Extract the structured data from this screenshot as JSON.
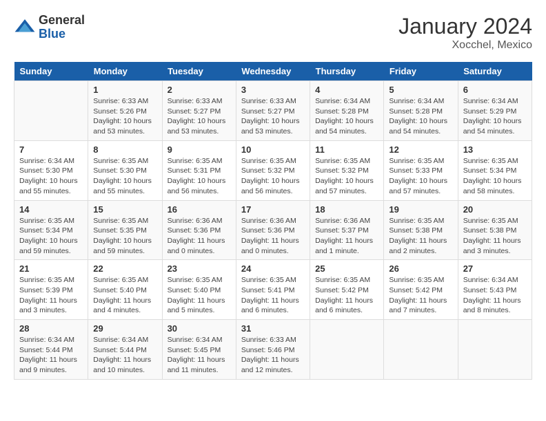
{
  "header": {
    "logo_general": "General",
    "logo_blue": "Blue",
    "month_year": "January 2024",
    "location": "Xocchel, Mexico"
  },
  "days_of_week": [
    "Sunday",
    "Monday",
    "Tuesday",
    "Wednesday",
    "Thursday",
    "Friday",
    "Saturday"
  ],
  "weeks": [
    [
      {
        "day": "",
        "info": ""
      },
      {
        "day": "1",
        "info": "Sunrise: 6:33 AM\nSunset: 5:26 PM\nDaylight: 10 hours\nand 53 minutes."
      },
      {
        "day": "2",
        "info": "Sunrise: 6:33 AM\nSunset: 5:27 PM\nDaylight: 10 hours\nand 53 minutes."
      },
      {
        "day": "3",
        "info": "Sunrise: 6:33 AM\nSunset: 5:27 PM\nDaylight: 10 hours\nand 53 minutes."
      },
      {
        "day": "4",
        "info": "Sunrise: 6:34 AM\nSunset: 5:28 PM\nDaylight: 10 hours\nand 54 minutes."
      },
      {
        "day": "5",
        "info": "Sunrise: 6:34 AM\nSunset: 5:28 PM\nDaylight: 10 hours\nand 54 minutes."
      },
      {
        "day": "6",
        "info": "Sunrise: 6:34 AM\nSunset: 5:29 PM\nDaylight: 10 hours\nand 54 minutes."
      }
    ],
    [
      {
        "day": "7",
        "info": "Sunrise: 6:34 AM\nSunset: 5:30 PM\nDaylight: 10 hours\nand 55 minutes."
      },
      {
        "day": "8",
        "info": "Sunrise: 6:35 AM\nSunset: 5:30 PM\nDaylight: 10 hours\nand 55 minutes."
      },
      {
        "day": "9",
        "info": "Sunrise: 6:35 AM\nSunset: 5:31 PM\nDaylight: 10 hours\nand 56 minutes."
      },
      {
        "day": "10",
        "info": "Sunrise: 6:35 AM\nSunset: 5:32 PM\nDaylight: 10 hours\nand 56 minutes."
      },
      {
        "day": "11",
        "info": "Sunrise: 6:35 AM\nSunset: 5:32 PM\nDaylight: 10 hours\nand 57 minutes."
      },
      {
        "day": "12",
        "info": "Sunrise: 6:35 AM\nSunset: 5:33 PM\nDaylight: 10 hours\nand 57 minutes."
      },
      {
        "day": "13",
        "info": "Sunrise: 6:35 AM\nSunset: 5:34 PM\nDaylight: 10 hours\nand 58 minutes."
      }
    ],
    [
      {
        "day": "14",
        "info": "Sunrise: 6:35 AM\nSunset: 5:34 PM\nDaylight: 10 hours\nand 59 minutes."
      },
      {
        "day": "15",
        "info": "Sunrise: 6:35 AM\nSunset: 5:35 PM\nDaylight: 10 hours\nand 59 minutes."
      },
      {
        "day": "16",
        "info": "Sunrise: 6:36 AM\nSunset: 5:36 PM\nDaylight: 11 hours\nand 0 minutes."
      },
      {
        "day": "17",
        "info": "Sunrise: 6:36 AM\nSunset: 5:36 PM\nDaylight: 11 hours\nand 0 minutes."
      },
      {
        "day": "18",
        "info": "Sunrise: 6:36 AM\nSunset: 5:37 PM\nDaylight: 11 hours\nand 1 minute."
      },
      {
        "day": "19",
        "info": "Sunrise: 6:35 AM\nSunset: 5:38 PM\nDaylight: 11 hours\nand 2 minutes."
      },
      {
        "day": "20",
        "info": "Sunrise: 6:35 AM\nSunset: 5:38 PM\nDaylight: 11 hours\nand 3 minutes."
      }
    ],
    [
      {
        "day": "21",
        "info": "Sunrise: 6:35 AM\nSunset: 5:39 PM\nDaylight: 11 hours\nand 3 minutes."
      },
      {
        "day": "22",
        "info": "Sunrise: 6:35 AM\nSunset: 5:40 PM\nDaylight: 11 hours\nand 4 minutes."
      },
      {
        "day": "23",
        "info": "Sunrise: 6:35 AM\nSunset: 5:40 PM\nDaylight: 11 hours\nand 5 minutes."
      },
      {
        "day": "24",
        "info": "Sunrise: 6:35 AM\nSunset: 5:41 PM\nDaylight: 11 hours\nand 6 minutes."
      },
      {
        "day": "25",
        "info": "Sunrise: 6:35 AM\nSunset: 5:42 PM\nDaylight: 11 hours\nand 6 minutes."
      },
      {
        "day": "26",
        "info": "Sunrise: 6:35 AM\nSunset: 5:42 PM\nDaylight: 11 hours\nand 7 minutes."
      },
      {
        "day": "27",
        "info": "Sunrise: 6:34 AM\nSunset: 5:43 PM\nDaylight: 11 hours\nand 8 minutes."
      }
    ],
    [
      {
        "day": "28",
        "info": "Sunrise: 6:34 AM\nSunset: 5:44 PM\nDaylight: 11 hours\nand 9 minutes."
      },
      {
        "day": "29",
        "info": "Sunrise: 6:34 AM\nSunset: 5:44 PM\nDaylight: 11 hours\nand 10 minutes."
      },
      {
        "day": "30",
        "info": "Sunrise: 6:34 AM\nSunset: 5:45 PM\nDaylight: 11 hours\nand 11 minutes."
      },
      {
        "day": "31",
        "info": "Sunrise: 6:33 AM\nSunset: 5:46 PM\nDaylight: 11 hours\nand 12 minutes."
      },
      {
        "day": "",
        "info": ""
      },
      {
        "day": "",
        "info": ""
      },
      {
        "day": "",
        "info": ""
      }
    ]
  ]
}
